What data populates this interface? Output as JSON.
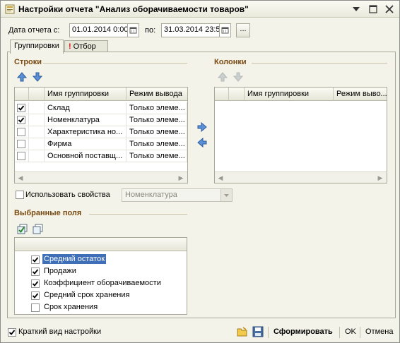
{
  "window": {
    "title": "Настройки отчета \"Анализ оборачиваемости товаров\""
  },
  "period": {
    "from_label": "Дата отчета с:",
    "from_value": "01.01.2014  0:00",
    "to_label": "по:",
    "to_value": "31.03.2014 23:5",
    "more_label": "..."
  },
  "tabs": [
    {
      "label": "Группировки",
      "active": true
    },
    {
      "label": "Отбор",
      "active": false,
      "marker": "!"
    }
  ],
  "rows_section": {
    "title": "Строки",
    "columns": [
      "Имя группировки",
      "Режим вывода"
    ],
    "items": [
      {
        "name": "Склад",
        "mode": "Только элеме...",
        "checked": true
      },
      {
        "name": "Номенклатура",
        "mode": "Только элеме...",
        "checked": true
      },
      {
        "name": "Характеристика но...",
        "mode": "Только элеме...",
        "checked": false
      },
      {
        "name": "Фирма",
        "mode": "Только элеме...",
        "checked": false
      },
      {
        "name": "Основной поставщ...",
        "mode": "Только элеме...",
        "checked": false
      }
    ]
  },
  "columns_section": {
    "title": "Колонки",
    "columns": [
      "Имя группировки",
      "Режим выво..."
    ]
  },
  "use_properties": {
    "label": "Использовать свойства",
    "checked": false,
    "select_value": "Номенклатура"
  },
  "selected_fields": {
    "title": "Выбранные поля",
    "items": [
      {
        "label": "Средний остаток",
        "checked": true,
        "selected": true
      },
      {
        "label": "Продажи",
        "checked": true,
        "selected": false
      },
      {
        "label": "Коэффициент оборачиваемости",
        "checked": true,
        "selected": false
      },
      {
        "label": "Средний срок хранения",
        "checked": true,
        "selected": false
      },
      {
        "label": "Срок хранения",
        "checked": false,
        "selected": false
      }
    ]
  },
  "footer": {
    "brief_label": "Краткий вид настройки",
    "brief_checked": true,
    "generate_label": "Сформировать",
    "ok_label": "OK",
    "cancel_label": "Отмена"
  },
  "colors": {
    "accent_title": "#7a4a12",
    "selection": "#3f6fb6",
    "window_bg": "#f3f3e9"
  }
}
